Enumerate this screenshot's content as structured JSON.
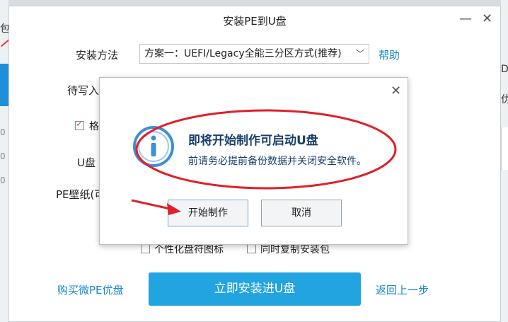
{
  "background": {
    "left_text": "包",
    "right_text_1": "D",
    "right_text_2": "仂",
    "left_numbers": [
      "0",
      "0",
      "0"
    ]
  },
  "window": {
    "title": "安装PE到U盘",
    "minimize": "—",
    "close": "✕"
  },
  "form": {
    "install_method_label": "安装方法",
    "install_method_value": "方案一：UEFI/Legacy全能三分区方式(推荐)",
    "help_link": "帮助",
    "write_label_partial": "待写入",
    "format_label_partial": "格",
    "udisk_label_partial": "U盘",
    "wallpaper_label_partial": "PE壁纸(可",
    "option_1": "个性化盘符图标",
    "option_2": "同时复制安装包"
  },
  "footer": {
    "buy_link": "购买微PE优盘",
    "install_button": "立即安装进U盘",
    "back_link": "返回上一步"
  },
  "dialog": {
    "close": "✕",
    "title": "即将开始制作可启动U盘",
    "message": "前请务必提前备份数据并关闭安全软件。",
    "start_button": "开始制作",
    "cancel_button": "取消"
  },
  "colors": {
    "accent": "#22a4e0",
    "link": "#1a86d0",
    "annotation": "#e0202a",
    "dialog_text": "#1a3f6b"
  }
}
